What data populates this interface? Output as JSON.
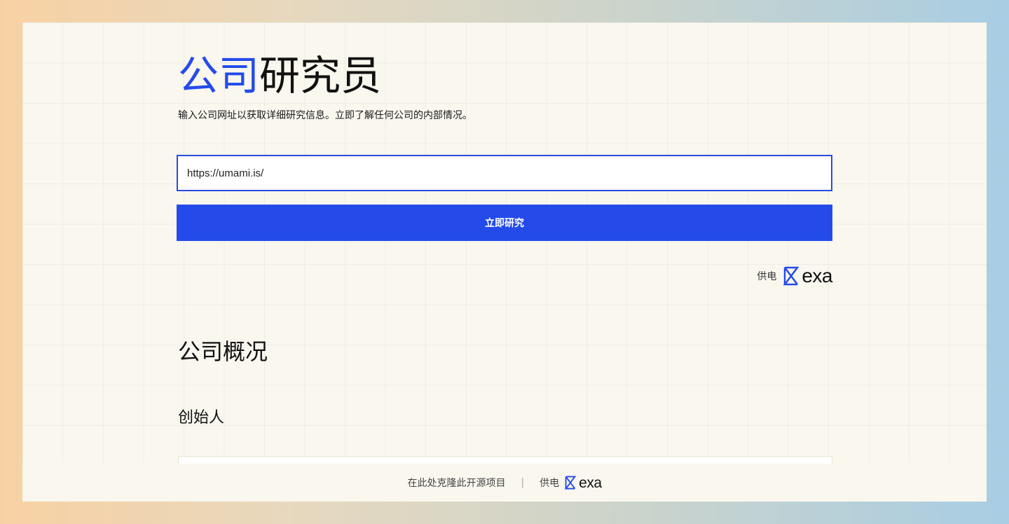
{
  "header": {
    "title_accent": "公司",
    "title_rest": "研究员",
    "subtitle": "输入公司网址以获取详细研究信息。立即了解任何公司的内部情况。"
  },
  "form": {
    "url_value": "https://umami.is/",
    "submit_label": "立即研究"
  },
  "powered_by": {
    "label": "供电",
    "brand": "exa",
    "brand_icon": "exa-logo-icon",
    "brand_color": "#244be9"
  },
  "sections": {
    "overview_title": "公司概况",
    "founders_title": "创始人"
  },
  "footer": {
    "clone_link": "在此处克隆此开源项目",
    "separator": "|",
    "powered_label": "供电",
    "brand": "exa"
  },
  "colors": {
    "accent": "#244be9",
    "background": "#f9f7ee"
  }
}
